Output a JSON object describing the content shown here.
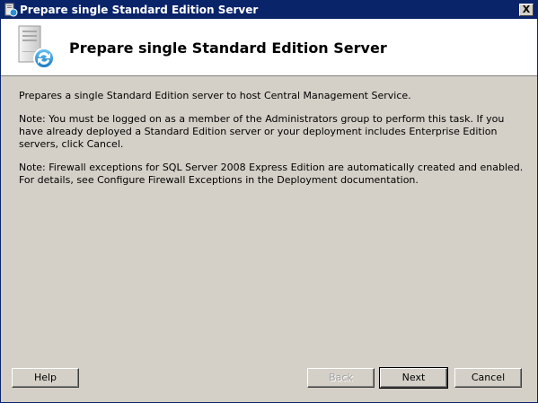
{
  "window": {
    "title": "Prepare single Standard Edition Server",
    "close_label": "X"
  },
  "header": {
    "title": "Prepare single Standard Edition Server",
    "icon": "server-setup-icon"
  },
  "content": {
    "paragraphs": [
      "Prepares a single Standard Edition server to host Central Management Service.",
      "Note: You must be logged on as a member of the Administrators group to perform this task. If you have already deployed a Standard Edition server or your deployment includes Enterprise Edition servers, click Cancel.",
      "Note: Firewall exceptions for SQL Server 2008 Express Edition are automatically created and enabled. For details, see Configure Firewall Exceptions in the Deployment documentation."
    ]
  },
  "buttons": {
    "help": "Help",
    "back": "Back",
    "next": "Next",
    "cancel": "Cancel"
  },
  "colors": {
    "titlebar": "#0a246a",
    "face": "#d4d0c8",
    "header_bg": "#ffffff"
  }
}
